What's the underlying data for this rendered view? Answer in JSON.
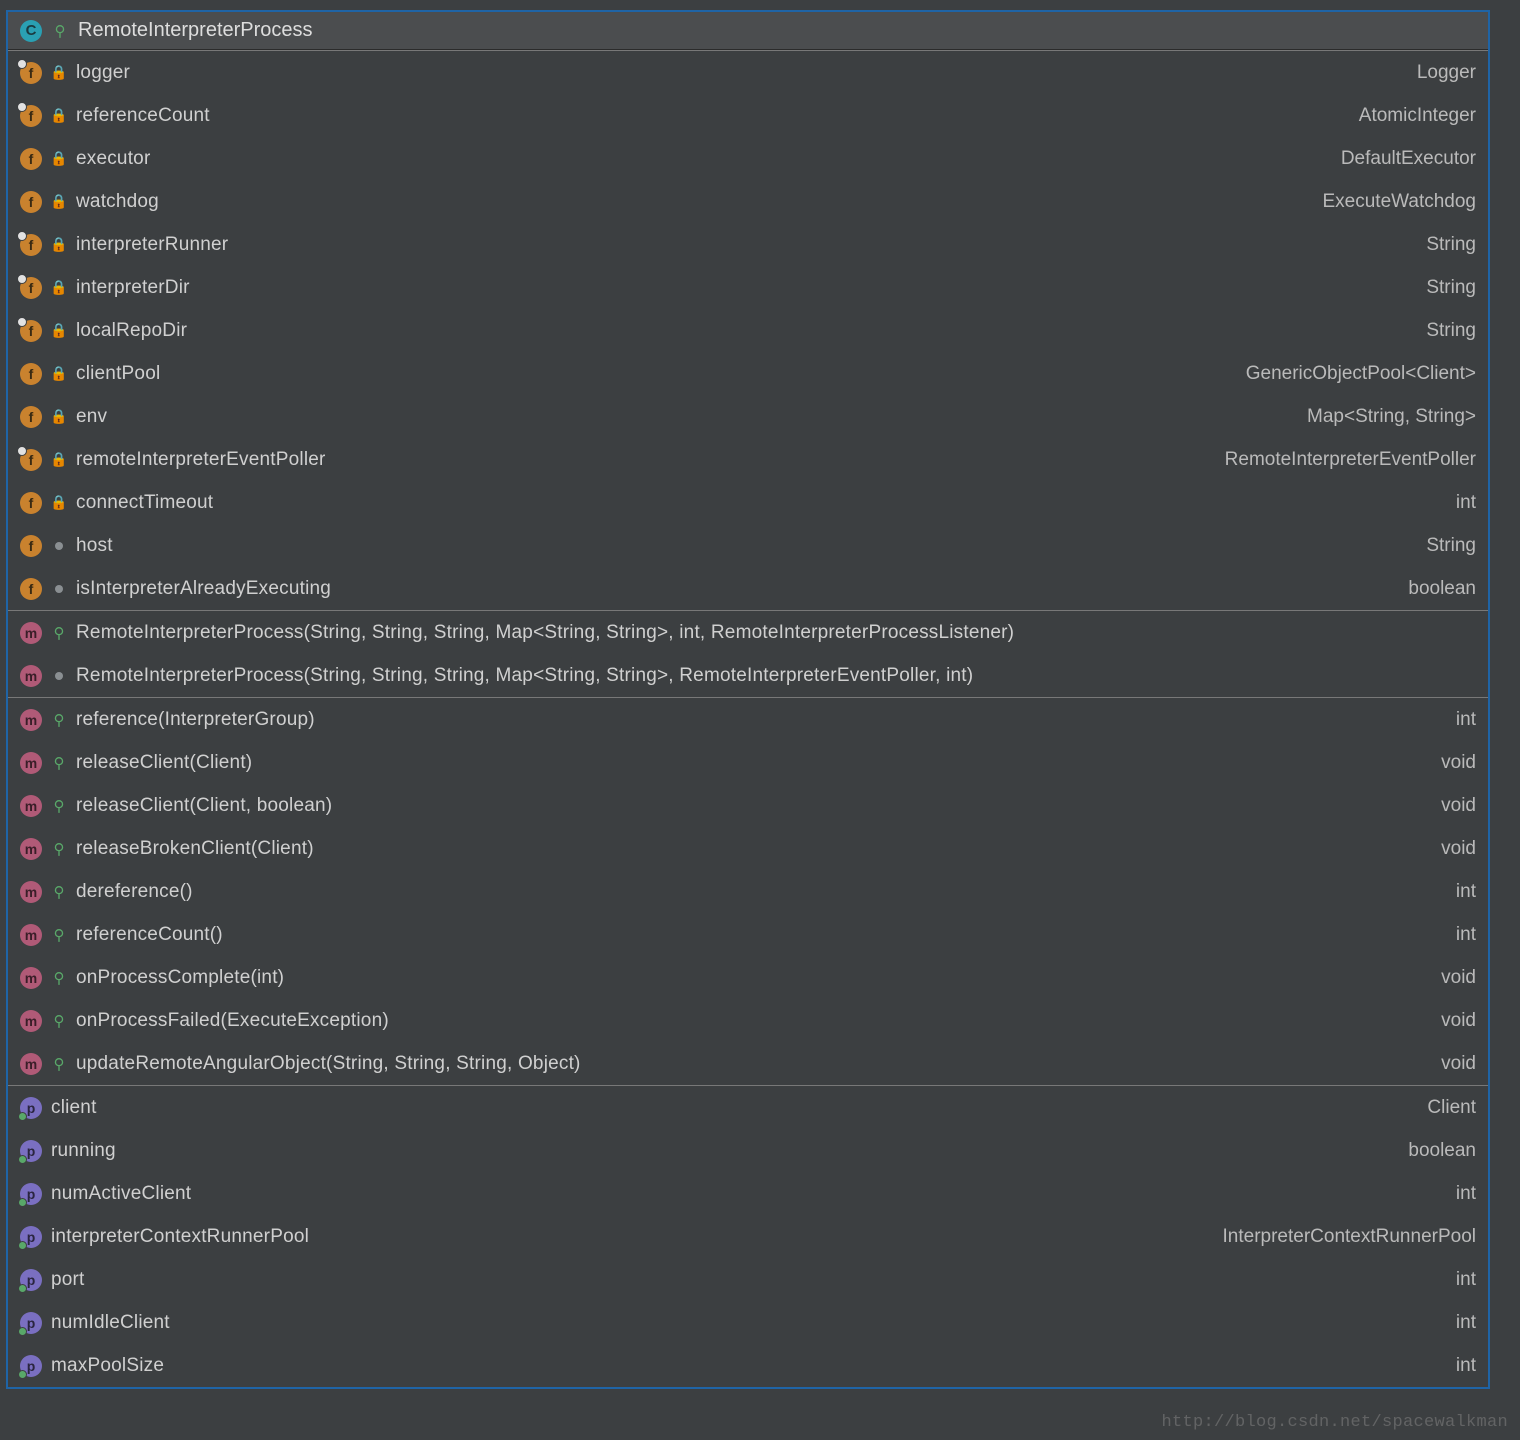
{
  "header": {
    "name": "RemoteInterpreterProcess"
  },
  "fields": [
    {
      "icon": "f",
      "overlay": true,
      "mod": "lock",
      "name": "logger",
      "type": "Logger"
    },
    {
      "icon": "f",
      "overlay": true,
      "mod": "lock",
      "name": "referenceCount",
      "type": "AtomicInteger"
    },
    {
      "icon": "f",
      "overlay": false,
      "mod": "lock",
      "name": "executor",
      "type": "DefaultExecutor"
    },
    {
      "icon": "f",
      "overlay": false,
      "mod": "lock",
      "name": "watchdog",
      "type": "ExecuteWatchdog"
    },
    {
      "icon": "f",
      "overlay": true,
      "mod": "lock",
      "name": "interpreterRunner",
      "type": "String"
    },
    {
      "icon": "f",
      "overlay": true,
      "mod": "lock",
      "name": "interpreterDir",
      "type": "String"
    },
    {
      "icon": "f",
      "overlay": true,
      "mod": "lock",
      "name": "localRepoDir",
      "type": "String"
    },
    {
      "icon": "f",
      "overlay": false,
      "mod": "lock",
      "name": "clientPool",
      "type": "GenericObjectPool<Client>"
    },
    {
      "icon": "f",
      "overlay": false,
      "mod": "lock",
      "name": "env",
      "type": "Map<String, String>"
    },
    {
      "icon": "f",
      "overlay": true,
      "mod": "lock",
      "name": "remoteInterpreterEventPoller",
      "type": "RemoteInterpreterEventPoller"
    },
    {
      "icon": "f",
      "overlay": false,
      "mod": "lock",
      "name": "connectTimeout",
      "type": "int"
    },
    {
      "icon": "f",
      "overlay": false,
      "mod": "dot",
      "name": "host",
      "type": "String"
    },
    {
      "icon": "f",
      "overlay": false,
      "mod": "dot",
      "name": "isInterpreterAlreadyExecuting",
      "type": "boolean"
    }
  ],
  "constructors": [
    {
      "icon": "m",
      "mod": "green",
      "name": "RemoteInterpreterProcess(String, String, String, Map<String, String>, int, RemoteInterpreterProcessListener)"
    },
    {
      "icon": "m",
      "mod": "dot",
      "name": "RemoteInterpreterProcess(String, String, String, Map<String, String>, RemoteInterpreterEventPoller, int)"
    }
  ],
  "methods": [
    {
      "icon": "m",
      "mod": "green",
      "name": "reference(InterpreterGroup)",
      "type": "int"
    },
    {
      "icon": "m",
      "mod": "green",
      "name": "releaseClient(Client)",
      "type": "void"
    },
    {
      "icon": "m",
      "mod": "green",
      "name": "releaseClient(Client, boolean)",
      "type": "void"
    },
    {
      "icon": "m",
      "mod": "green",
      "name": "releaseBrokenClient(Client)",
      "type": "void"
    },
    {
      "icon": "m",
      "mod": "green",
      "name": "dereference()",
      "type": "int"
    },
    {
      "icon": "m",
      "mod": "green",
      "name": "referenceCount()",
      "type": "int"
    },
    {
      "icon": "m",
      "mod": "green",
      "name": "onProcessComplete(int)",
      "type": "void"
    },
    {
      "icon": "m",
      "mod": "green",
      "name": "onProcessFailed(ExecuteException)",
      "type": "void"
    },
    {
      "icon": "m",
      "mod": "green",
      "name": "updateRemoteAngularObject(String, String, String, Object)",
      "type": "void"
    }
  ],
  "properties": [
    {
      "icon": "p",
      "name": "client",
      "type": "Client"
    },
    {
      "icon": "p",
      "name": "running",
      "type": "boolean"
    },
    {
      "icon": "p",
      "name": "numActiveClient",
      "type": "int"
    },
    {
      "icon": "p",
      "name": "interpreterContextRunnerPool",
      "type": "InterpreterContextRunnerPool"
    },
    {
      "icon": "p",
      "name": "port",
      "type": "int"
    },
    {
      "icon": "p",
      "name": "numIdleClient",
      "type": "int"
    },
    {
      "icon": "p",
      "name": "maxPoolSize",
      "type": "int"
    }
  ],
  "watermark": "http://blog.csdn.net/spacewalkman"
}
